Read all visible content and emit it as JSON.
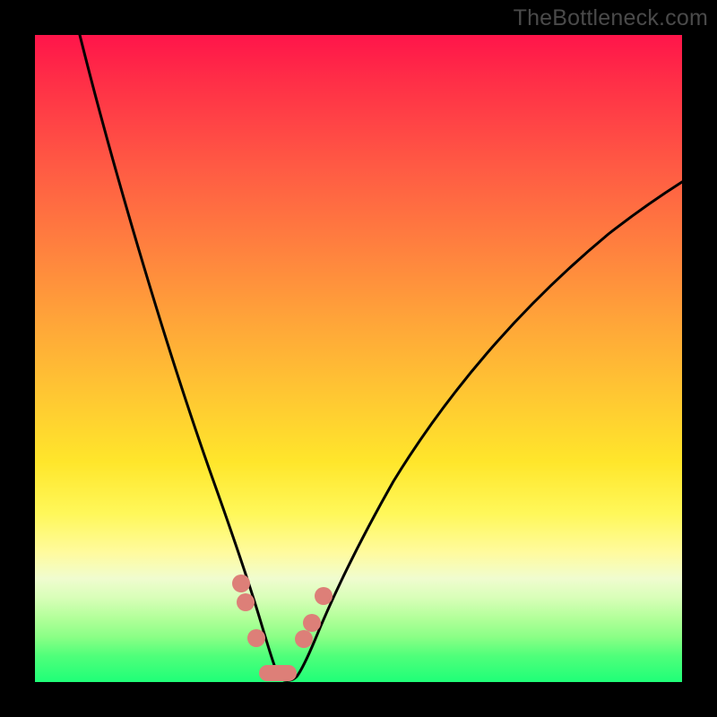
{
  "watermark": "TheBottleneck.com",
  "colors": {
    "curve": "#000000",
    "beads": "#dd7f78",
    "bg_top": "#ff154a",
    "bg_bottom": "#1fff78"
  },
  "chart_data": {
    "type": "line",
    "title": "",
    "xlabel": "",
    "ylabel": "",
    "xlim": [
      0,
      100
    ],
    "ylim": [
      0,
      100
    ],
    "series": [
      {
        "name": "bottleneck-curve",
        "x": [
          7,
          10,
          14,
          18,
          22,
          25,
          27,
          29,
          31,
          33,
          34,
          35,
          36,
          37,
          38,
          39,
          40,
          42,
          44,
          47,
          52,
          58,
          66,
          76,
          88,
          100
        ],
        "y": [
          100,
          90,
          78,
          66,
          53,
          42,
          34,
          27,
          20,
          13,
          9,
          5,
          2,
          0,
          0,
          0,
          1,
          4,
          9,
          16,
          26,
          37,
          49,
          60,
          70,
          78
        ]
      }
    ],
    "markers": [
      {
        "x": 31.8,
        "y": 15.2
      },
      {
        "x": 32.5,
        "y": 12.3
      },
      {
        "x": 34.2,
        "y": 6.8
      },
      {
        "x": 41.6,
        "y": 6.6
      },
      {
        "x": 42.8,
        "y": 9.2
      },
      {
        "x": 44.6,
        "y": 13.3
      }
    ],
    "floor_segment": {
      "x0": 34.6,
      "x1": 40.5,
      "y": 1.2
    },
    "notes": "V-shaped bottleneck curve over a vertical red→green gradient. Minimum (~0) near x≈37–39. Small salmon markers cluster around the trough; a salmon rounded bar sits along the bottom between the two arms."
  }
}
